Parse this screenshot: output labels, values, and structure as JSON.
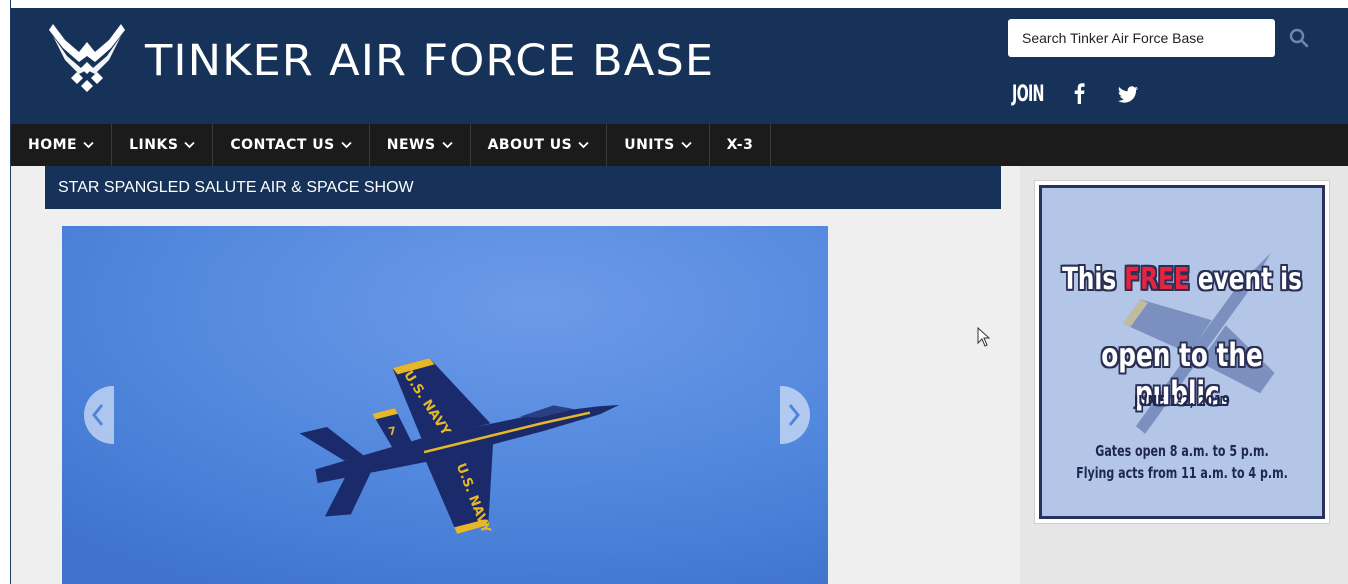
{
  "header": {
    "site_title": "TINKER AIR FORCE BASE",
    "search_placeholder": "Search Tinker Air Force Base",
    "join_label": "JOIN",
    "logo_icon": "usaf-wings-logo-icon",
    "social": [
      "facebook-icon",
      "twitter-icon"
    ]
  },
  "nav": {
    "items": [
      {
        "label": "HOME"
      },
      {
        "label": "LINKS"
      },
      {
        "label": "CONTACT US"
      },
      {
        "label": "NEWS"
      },
      {
        "label": "ABOUT US"
      },
      {
        "label": "UNITS"
      },
      {
        "label": "X-3"
      }
    ]
  },
  "main": {
    "page_title": "STAR SPANGLED SALUTE AIR & SPACE SHOW",
    "slide": {
      "aircraft_text_top": "U.S. NAVY",
      "aircraft_text_bottom": "U.S. NAVY",
      "aircraft_number": "7"
    }
  },
  "ad": {
    "line1_pre": "This ",
    "line1_free": "FREE",
    "line1_post": " event is",
    "line2": "open to the public.",
    "date": "JUNE 1-2, 2019",
    "gates": "Gates open 8 a.m. to 5 p.m.",
    "flying": "Flying acts from 11 a.m. to 4 p.m."
  },
  "colors": {
    "header_bg": "#163259",
    "nav_bg": "#1b1b1b",
    "sky": "#4f86dc",
    "free_red": "#e8233f"
  }
}
